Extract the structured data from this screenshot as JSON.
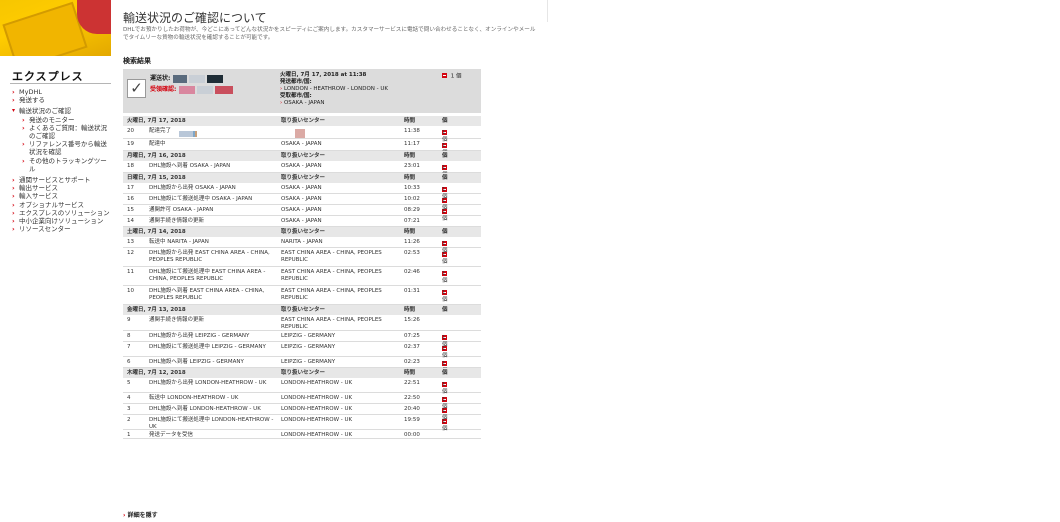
{
  "header": {
    "title": "輸送状況のご確認について",
    "intro": "DHLでお預かりしたお荷物が、今どこにあってどんな状況かをスピーディにご案内します。カスタマーサービスに電話で問い合わせることなく、オンラインやメールでタイムリーな貨物の輸送状況を確認することが可能です。"
  },
  "sidebar": {
    "title": "エクスプレス",
    "items": [
      {
        "label": "MyDHL",
        "level": 0
      },
      {
        "label": "発送する",
        "level": 0
      },
      {
        "label": "輸送状況のご確認",
        "level": 0
      },
      {
        "label": "発送のモニター",
        "level": 1
      },
      {
        "label": "よくあるご質問：輸送状況のご確認",
        "level": 1
      },
      {
        "label": "リファレンス番号から輸送状況を確認",
        "level": 1
      },
      {
        "label": "その他のトラッキングツール",
        "level": 1
      },
      {
        "label": "通関サービスとサポート",
        "level": 0
      },
      {
        "label": "輸出サービス",
        "level": 0
      },
      {
        "label": "輸入サービス",
        "level": 0
      },
      {
        "label": "オプショナルサービス",
        "level": 0
      },
      {
        "label": "エクスプレスのソリューション",
        "level": 0
      },
      {
        "label": "中小企業向けソリューション",
        "level": 0
      },
      {
        "label": "リソースセンター",
        "level": 0
      }
    ]
  },
  "results": {
    "title": "検索結果",
    "summary": {
      "waybill_label": "運送状:",
      "receiver_label": "受領確認:",
      "datetime": "火曜日, 7月 17, 2018 at 11:38",
      "origin_label": "発送都市/国:",
      "origin": "LONDON - HEATHROW - LONDON - UK",
      "dest_label": "受取都市/国:",
      "dest": "OSAKA - JAPAN",
      "pieces": "1 個"
    },
    "col_center": "取り扱いセンター",
    "col_time": "時間",
    "col_pieces": "個",
    "days": [
      {
        "date": "火曜日, 7月 17, 2018",
        "events": [
          {
            "no": "20",
            "desc": "配達完了",
            "center": "",
            "time": "11:38",
            "pieces": "1 個"
          },
          {
            "no": "19",
            "desc": "配達中",
            "center": "OSAKA - JAPAN",
            "time": "11:17",
            "pieces": "1 個"
          }
        ]
      },
      {
        "date": "月曜日, 7月 16, 2018",
        "events": [
          {
            "no": "18",
            "desc": "DHL施設へ到着 OSAKA - JAPAN",
            "center": "OSAKA - JAPAN",
            "time": "23:01",
            "pieces": "1 個"
          }
        ]
      },
      {
        "date": "日曜日, 7月 15, 2018",
        "events": [
          {
            "no": "17",
            "desc": "DHL施設から出発 OSAKA - JAPAN",
            "center": "OSAKA - JAPAN",
            "time": "10:33",
            "pieces": "1 個"
          },
          {
            "no": "16",
            "desc": "DHL施設にて搬送処理中 OSAKA - JAPAN",
            "center": "OSAKA - JAPAN",
            "time": "10:02",
            "pieces": "1 個"
          },
          {
            "no": "15",
            "desc": "通関許可 OSAKA - JAPAN",
            "center": "OSAKA - JAPAN",
            "time": "08:29",
            "pieces": "1 個"
          },
          {
            "no": "14",
            "desc": "通関手続き情報の更新",
            "center": "OSAKA - JAPAN",
            "time": "07:21",
            "pieces": ""
          }
        ]
      },
      {
        "date": "土曜日, 7月 14, 2018",
        "events": [
          {
            "no": "13",
            "desc": "転送中 NARITA - JAPAN",
            "center": "NARITA - JAPAN",
            "time": "11:26",
            "pieces": "1 個"
          },
          {
            "no": "12",
            "desc": "DHL施設から出発 EAST CHINA AREA - CHINA, PEOPLES REPUBLIC",
            "center": "EAST CHINA AREA - CHINA, PEOPLES REPUBLIC",
            "time": "02:53",
            "pieces": "1 個"
          },
          {
            "no": "11",
            "desc": "DHL施設にて搬送処理中 EAST CHINA AREA - CHINA, PEOPLES REPUBLIC",
            "center": "EAST CHINA AREA - CHINA, PEOPLES REPUBLIC",
            "time": "02:46",
            "pieces": "1 個"
          },
          {
            "no": "10",
            "desc": "DHL施設へ到着 EAST CHINA AREA - CHINA, PEOPLES REPUBLIC",
            "center": "EAST CHINA AREA - CHINA, PEOPLES REPUBLIC",
            "time": "01:31",
            "pieces": "1 個"
          }
        ]
      },
      {
        "date": "金曜日, 7月 13, 2018",
        "events": [
          {
            "no": "9",
            "desc": "通関手続き情報の更新",
            "center": "EAST CHINA AREA - CHINA, PEOPLES REPUBLIC",
            "time": "15:26",
            "pieces": ""
          },
          {
            "no": "8",
            "desc": "DHL施設から出発 LEIPZIG - GERMANY",
            "center": "LEIPZIG - GERMANY",
            "time": "07:25",
            "pieces": "1 個"
          },
          {
            "no": "7",
            "desc": "DHL施設にて搬送処理中 LEIPZIG - GERMANY",
            "center": "LEIPZIG - GERMANY",
            "time": "02:37",
            "pieces": "1 個"
          },
          {
            "no": "6",
            "desc": "DHL施設へ到着 LEIPZIG - GERMANY",
            "center": "LEIPZIG - GERMANY",
            "time": "02:23",
            "pieces": "1 個"
          }
        ]
      },
      {
        "date": "木曜日, 7月 12, 2018",
        "events": [
          {
            "no": "5",
            "desc": "DHL施設から出発 LONDON-HEATHROW - UK",
            "center": "LONDON-HEATHROW - UK",
            "time": "22:51",
            "pieces": "1 個"
          },
          {
            "no": "4",
            "desc": "転送中 LONDON-HEATHROW - UK",
            "center": "LONDON-HEATHROW - UK",
            "time": "22:50",
            "pieces": "1 個"
          },
          {
            "no": "3",
            "desc": "DHL施設へ到着 LONDON-HEATHROW - UK",
            "center": "LONDON-HEATHROW - UK",
            "time": "20:40",
            "pieces": "1 個"
          },
          {
            "no": "2",
            "desc": "DHL施設にて搬送処理中 LONDON-HEATHROW - UK",
            "center": "LONDON-HEATHROW - UK",
            "time": "19:59",
            "pieces": "1 個"
          },
          {
            "no": "1",
            "desc": "発送データを受信",
            "center": "LONDON-HEATHROW - UK",
            "time": "00:00",
            "pieces": ""
          }
        ]
      }
    ],
    "more_label": "詳細を隠す"
  },
  "colors": {
    "accent": "#d40511",
    "brand_yellow": "#ffcc00",
    "header_bg": "#e7e7e7"
  }
}
